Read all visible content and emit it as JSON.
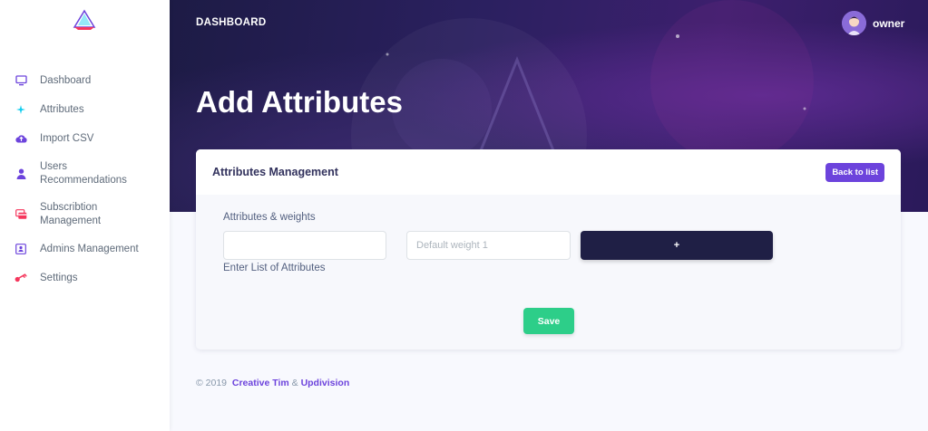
{
  "sidebar": {
    "items": [
      {
        "label": "Dashboard",
        "icon": "monitor-icon",
        "color": "#6c43dc"
      },
      {
        "label": "Attributes",
        "icon": "sparkle-icon",
        "color": "#11cdef"
      },
      {
        "label": "Import CSV",
        "icon": "cloud-upload-icon",
        "color": "#6c43dc"
      },
      {
        "label": "Users Recommendations",
        "icon": "user-icon",
        "color": "#6c43dc"
      },
      {
        "label": "Subscribtion Management",
        "icon": "cards-icon",
        "color": "#f5365c"
      },
      {
        "label": "Admins Management",
        "icon": "id-card-icon",
        "color": "#6c43dc"
      },
      {
        "label": "Settings",
        "icon": "key-icon",
        "color": "#f5365c"
      }
    ]
  },
  "topbar": {
    "title": "DASHBOARD",
    "user_name": "owner"
  },
  "page": {
    "title": "Add Attributes"
  },
  "card": {
    "title": "Attributes Management",
    "back_label": "Back to list",
    "field_label": "Attributes & weights",
    "attribute_value": "",
    "weight_placeholder": "Default weight 1",
    "add_label": "+",
    "help_text": "Enter List of Attributes",
    "save_label": "Save"
  },
  "footer": {
    "copyright": "© 2019",
    "link1": "Creative Tim",
    "separator": "&",
    "link2": "Updivision"
  },
  "colors": {
    "primary": "#6c43dc",
    "dark": "#1f1f45",
    "success": "#2dce89"
  }
}
